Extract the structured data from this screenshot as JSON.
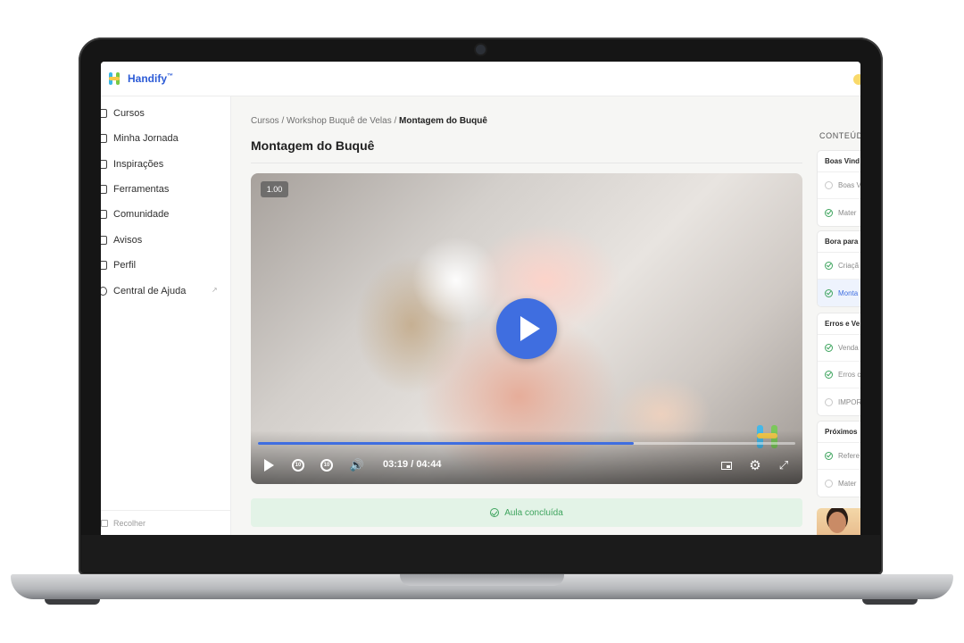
{
  "app": {
    "name": "Handify",
    "trademark": "™"
  },
  "sidebar": {
    "items": [
      {
        "label": "Cursos",
        "icon": "home-icon"
      },
      {
        "label": "Minha Jornada",
        "icon": "grid-icon"
      },
      {
        "label": "Inspirações",
        "icon": "book-icon"
      },
      {
        "label": "Ferramentas",
        "icon": "layers-icon"
      },
      {
        "label": "Comunidade",
        "icon": "chat-icon"
      },
      {
        "label": "Avisos",
        "icon": "award-icon"
      },
      {
        "label": "Perfil",
        "icon": "user-icon"
      },
      {
        "label": "Central de Ajuda",
        "icon": "help-icon",
        "external": true
      }
    ],
    "collapse_label": "Recolher"
  },
  "breadcrumb": {
    "root": "Cursos",
    "sep": "/",
    "course": "Workshop Buquê de Velas",
    "current": "Montagem do Buquê"
  },
  "page_title": "Montagem do Buquê",
  "player": {
    "speed": "1.00",
    "current_time": "03:19",
    "duration": "/ 04:44",
    "progress": 0.7,
    "skip_back": "10",
    "skip_forward": "10"
  },
  "completed_label": "Aula concluída",
  "content_panel": {
    "heading": "CONTEÚD",
    "modules": [
      {
        "title": "Boas Vind",
        "lessons": [
          {
            "label": "Boas V",
            "done": false,
            "active": false
          },
          {
            "label": "Mater",
            "done": true,
            "active": false
          }
        ]
      },
      {
        "title": "Bora para",
        "lessons": [
          {
            "label": "Criaçã",
            "done": true,
            "active": false
          },
          {
            "label": "Monta",
            "done": true,
            "active": true
          }
        ]
      },
      {
        "title": "Erros e Ve",
        "lessons": [
          {
            "label": "Venda",
            "done": true,
            "active": false
          },
          {
            "label": "Erros c",
            "done": true,
            "active": false
          },
          {
            "label": "IMPOR",
            "done": false,
            "active": false
          }
        ]
      },
      {
        "title": "Próximos",
        "lessons": [
          {
            "label": "Refere",
            "done": true,
            "active": false
          },
          {
            "label": "Mater",
            "done": false,
            "active": false
          }
        ]
      }
    ]
  },
  "colors": {
    "accent": "#3f6ee0",
    "success": "#3ea45e",
    "success_bg": "#e3f3e7"
  }
}
